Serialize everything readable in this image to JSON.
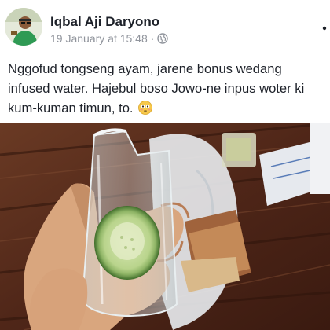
{
  "post": {
    "author": "Iqbal Aji Daryono",
    "timestamp": "19 January at 15:48 ·",
    "privacy_icon": "globe-icon",
    "more_icon": "more-options-icon",
    "text": "Nggofud tongseng ayam, jarene bonus wedang infused water. Hajebul boso Jowo-ne inpus woter ki kum-kuman timun, to.",
    "emoji": "flushed-face-emoji"
  },
  "colors": {
    "name": "#1d2129",
    "meta": "#90949c",
    "background": "#ffffff"
  }
}
